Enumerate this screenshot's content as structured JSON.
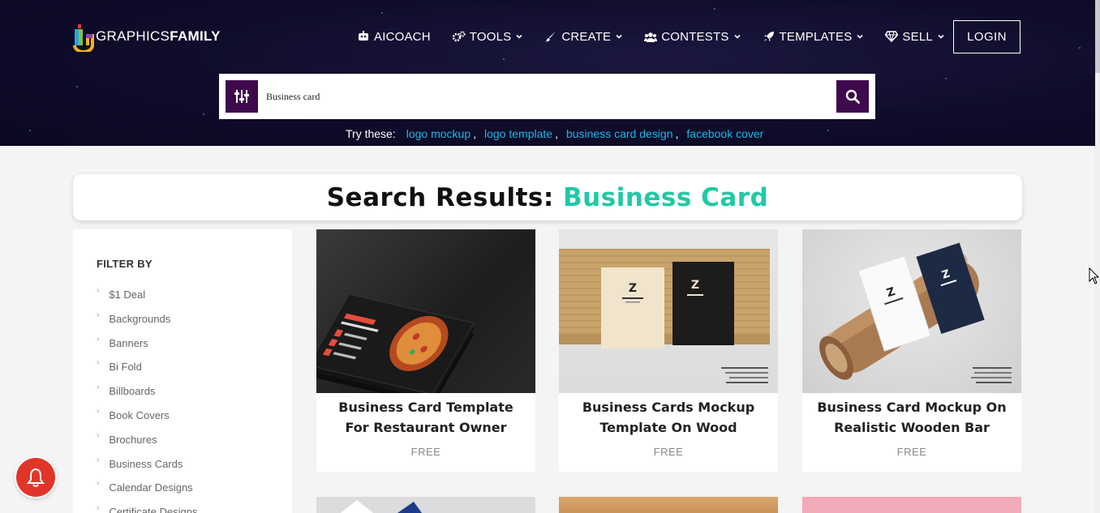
{
  "brand": {
    "logo_text_light": "GRAPHICS",
    "logo_text_bold": "FAMILY"
  },
  "nav": {
    "items": [
      {
        "label": "AICOACH",
        "icon": "robot-icon",
        "dropdown": false
      },
      {
        "label": "TOOLS",
        "icon": "cogs-icon",
        "dropdown": true
      },
      {
        "label": "CREATE",
        "icon": "brush-icon",
        "dropdown": true
      },
      {
        "label": "CONTESTS",
        "icon": "users-icon",
        "dropdown": true
      },
      {
        "label": "TEMPLATES",
        "icon": "rocket-icon",
        "dropdown": true
      },
      {
        "label": "SELL",
        "icon": "diamond-icon",
        "dropdown": true
      }
    ],
    "login_label": "LOGIN"
  },
  "search": {
    "value": "Business card"
  },
  "suggestions": {
    "label": "Try these:",
    "items": [
      "logo mockup",
      "logo template",
      "business card design",
      "facebook cover"
    ]
  },
  "results": {
    "prefix": "Search Results:",
    "query": "Business Card"
  },
  "sidebar": {
    "heading": "FILTER BY",
    "categories": [
      "$1 Deal",
      "Backgrounds",
      "Banners",
      "Bi Fold",
      "Billboards",
      "Book Covers",
      "Brochures",
      "Business Cards",
      "Calendar Designs",
      "Certificate Designs"
    ]
  },
  "products": [
    {
      "title": "Business Card Template For Restaurant Owner",
      "price": "FREE"
    },
    {
      "title": "Business Cards Mockup Template On Wood",
      "price": "FREE"
    },
    {
      "title": "Business Card Mockup On Realistic Wooden Bar",
      "price": "FREE"
    }
  ],
  "colors": {
    "accent": "#20c9a5",
    "purple": "#3e0a4d",
    "link": "#22b6e8",
    "header_bg": "#0f0c2a",
    "bell": "#e2352a"
  }
}
